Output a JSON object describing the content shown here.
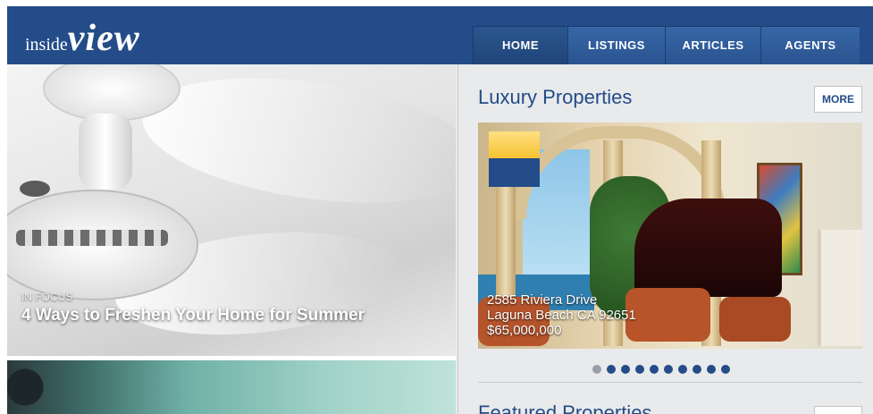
{
  "header": {
    "logo_small": "inside",
    "logo_big": "view",
    "nav": [
      {
        "label": "HOME",
        "active": true
      },
      {
        "label": "LISTINGS",
        "active": false
      },
      {
        "label": "ARTICLES",
        "active": false
      },
      {
        "label": "AGENTS",
        "active": false
      }
    ]
  },
  "feature": {
    "tag": "IN FOCUS",
    "title": "4 Ways to Freshen Your Home for Summer"
  },
  "luxury": {
    "title": "Luxury Properties",
    "more_label": "MORE",
    "caption_line1": "2585 Riviera Drive",
    "caption_line2": "Laguna Beach CA 92651",
    "caption_line3": "$65,000,000",
    "carousel_dots": 10,
    "active_dot": 0
  },
  "featured": {
    "title": "Featured Properties"
  },
  "colors": {
    "brand_blue": "#234c88",
    "background": "#e9eaec"
  }
}
